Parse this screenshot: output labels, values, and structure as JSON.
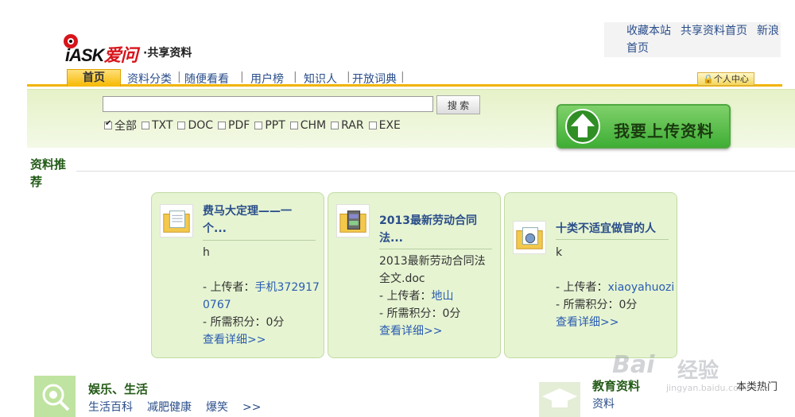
{
  "logo": {
    "brand_prefix": "iASK",
    "brand_cn": "爱问",
    "subtitle": "·共享资料"
  },
  "top_links": [
    "收藏本站",
    "共享资料首页",
    "新浪首页"
  ],
  "nav": {
    "home": "首页",
    "items": [
      "资料分类",
      "随便看看",
      "用户榜",
      "知识人",
      "开放词典"
    ],
    "user_center": "个人中心"
  },
  "search": {
    "value": "",
    "button": "搜 索",
    "filters": [
      {
        "label": "全部",
        "checked": true
      },
      {
        "label": "TXT",
        "checked": false
      },
      {
        "label": "DOC",
        "checked": false
      },
      {
        "label": "PDF",
        "checked": false
      },
      {
        "label": "PPT",
        "checked": false
      },
      {
        "label": "CHM",
        "checked": false
      },
      {
        "label": "RAR",
        "checked": false
      },
      {
        "label": "EXE",
        "checked": false
      }
    ]
  },
  "upload_button": "我要上传资料",
  "section_title": "资料推荐",
  "cards": [
    {
      "title_line1": "费马大定理——一",
      "title_line2": "个...",
      "desc": "h",
      "desc2": "",
      "uploader_label": "- 上传者：",
      "uploader": "手机3729170767",
      "points": "- 所需积分：0分",
      "more": "查看详细>>"
    },
    {
      "title_line1": "2013最新劳动合同",
      "title_line2": "法...",
      "desc": "2013最新劳动合同法",
      "desc2": "全文.doc",
      "uploader_label": "- 上传者：",
      "uploader": "地山",
      "points": "- 所需积分：0分",
      "more": "查看详细>>"
    },
    {
      "title_line1": "十类不适宜做官的人",
      "title_line2": "",
      "desc": "k",
      "desc2": "",
      "uploader_label": "- 上传者：",
      "uploader": "xiaoyahuozi",
      "points": "- 所需积分：0分",
      "more": "查看详细>>"
    }
  ],
  "category1": {
    "title": "娱乐、生活",
    "links": [
      "生活百科",
      "减肥健康",
      "爆笑",
      ">>"
    ]
  },
  "category2": {
    "title": "教育资料",
    "sub": "资料"
  },
  "hot_label": "本类热门",
  "watermark": {
    "brand": "Bai",
    "brand_cn": "经验",
    "url": "jingyan.baidu.com"
  }
}
